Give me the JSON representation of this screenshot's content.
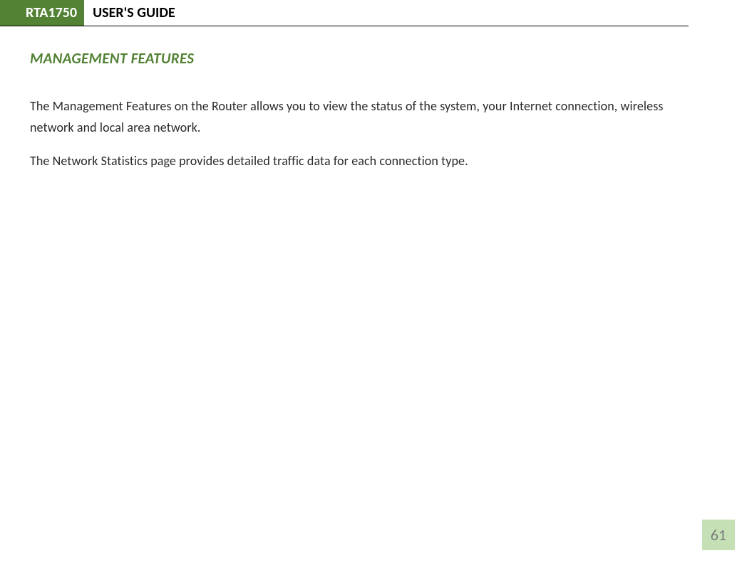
{
  "header": {
    "model": "RTA1750",
    "title": "USER'S GUIDE"
  },
  "section": {
    "heading": "MANAGEMENT FEATURES"
  },
  "paragraphs": {
    "p1": "The Management Features on the Router allows you to view the status of the system, your Internet connection, wireless network and local area network.",
    "p2": "The Network Statistics page provides detailed traffic data for each connection type."
  },
  "page_number": "61"
}
